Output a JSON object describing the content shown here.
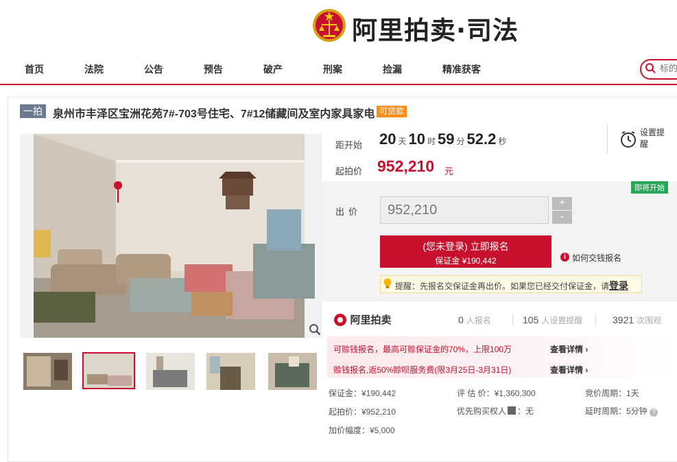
{
  "header": {
    "logo_text": "阿里拍卖·司法",
    "nav": [
      "首页",
      "法院",
      "公告",
      "预告",
      "破产",
      "刑案",
      "捡漏",
      "精准获客"
    ],
    "search_placeholder": "标的物"
  },
  "auction": {
    "round_tag": "一拍",
    "title": "泉州市丰泽区宝洲花苑7#-703号住宅、7#12储藏间及室内家具家电",
    "loan_badge": "可贷款"
  },
  "countdown": {
    "label": "距开始",
    "days": "20",
    "days_unit": "天",
    "hours": "10",
    "hours_unit": "时",
    "minutes": "59",
    "minutes_unit": "分",
    "seconds": "52.2",
    "seconds_unit": "秒",
    "reminder_label": "设置提醒"
  },
  "start_price": {
    "label": "起拍价",
    "value": "952,210",
    "unit": "元"
  },
  "bid": {
    "status_badge": "即将开始",
    "label": "出价",
    "input_value": "952,210",
    "plus": "+",
    "minus": "-",
    "signup_main": "(您未登录) 立即报名",
    "signup_sub": "保证金 ¥190,442",
    "how_to_pay": "如何交钱报名",
    "tip_text": "提醒：先报名交保证金再出价。如果您已经交付保证金，请",
    "tip_login": "登录"
  },
  "stats": {
    "brand": "阿里拍卖",
    "signups": "0",
    "signups_label": "人报名",
    "reminders": "105",
    "reminders_label": "人设置提醒",
    "views": "3921",
    "views_label": "次围观"
  },
  "promo": {
    "line1": "可赊钱报名，最高可赊保证金的70%，上限100万",
    "line1_link": "查看详情",
    "line2": "赊钱报名,返50%赊呗服务费(限3月25日-3月31日)",
    "line2_link": "查看详情"
  },
  "details": {
    "deposit": "保证金：¥190,442",
    "start": "起拍价：¥952,210",
    "increment": "加价幅度：¥5,000",
    "appraisal": "评 估 价：¥1,360,300",
    "priority_label": "优先购买权人",
    "priority_value": "：无",
    "cycle": "竞价周期：1天",
    "delay": "延时周期：5分钟"
  },
  "colors": {
    "accent": "#c8102e",
    "loan_badge": "#ff8d1a",
    "status_green": "#27a65a",
    "round_tag": "#6b7a8f"
  }
}
